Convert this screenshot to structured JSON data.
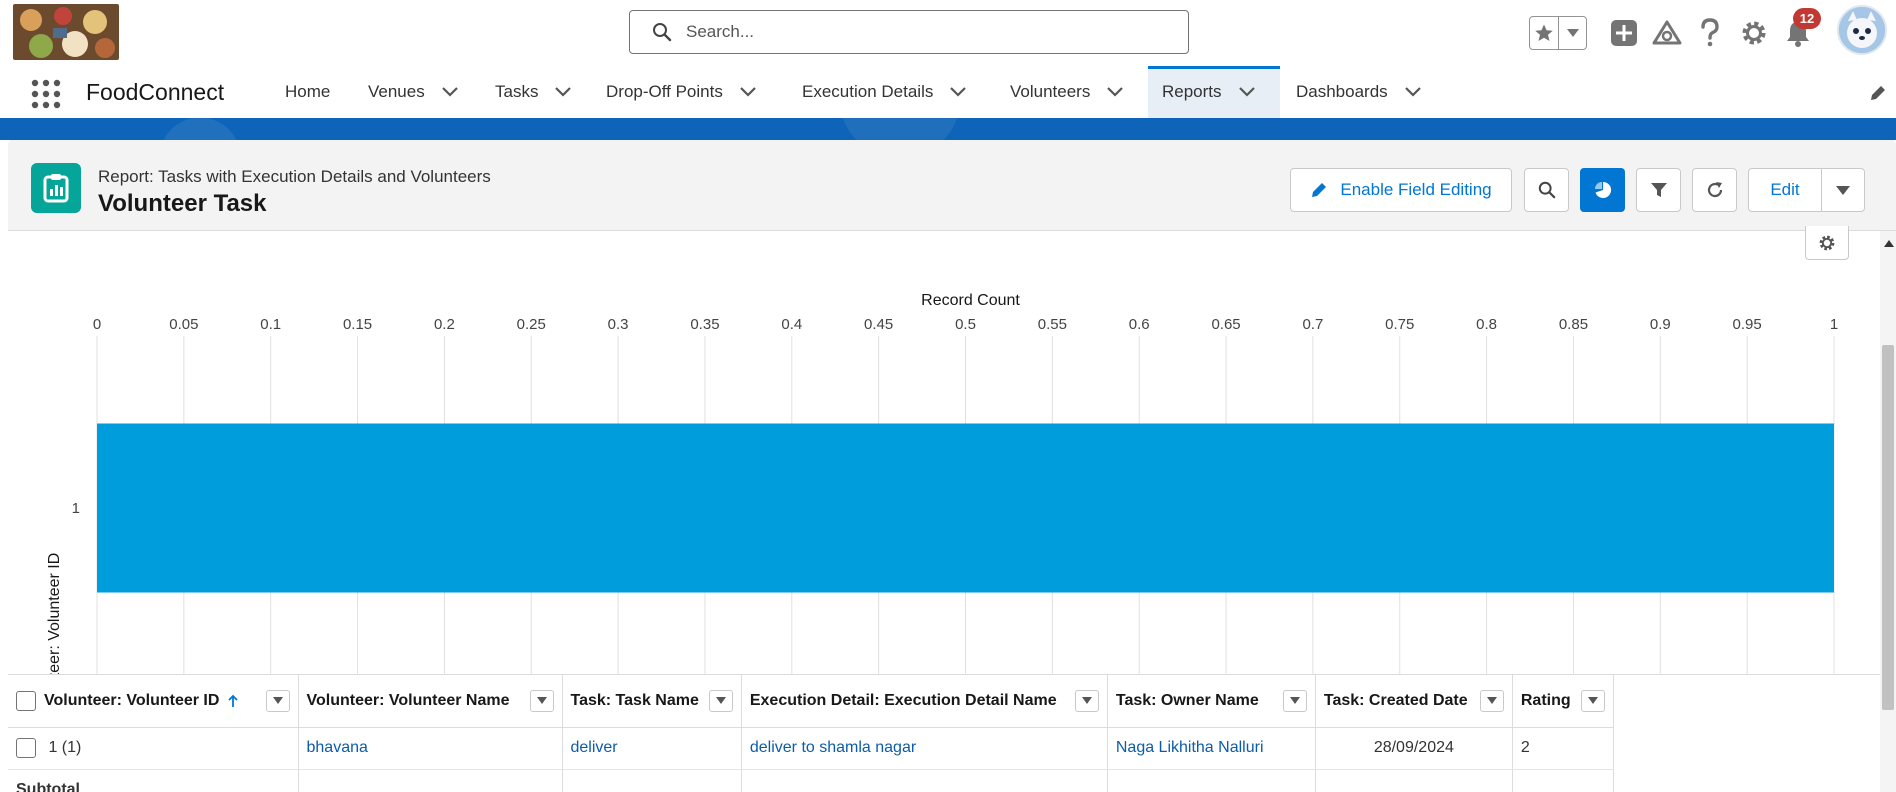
{
  "header": {
    "search_placeholder": "Search...",
    "notification_count": "12"
  },
  "nav": {
    "app_name": "FoodConnect",
    "items": [
      {
        "label": "Home"
      },
      {
        "label": "Venues"
      },
      {
        "label": "Tasks"
      },
      {
        "label": "Drop-Off Points"
      },
      {
        "label": "Execution Details"
      },
      {
        "label": "Volunteers"
      },
      {
        "label": "Reports"
      },
      {
        "label": "Dashboards"
      }
    ],
    "active": "Reports"
  },
  "report": {
    "type_label": "Report: Tasks with Execution Details and Volunteers",
    "title": "Volunteer Task",
    "enable_field_editing": "Enable Field Editing",
    "edit_label": "Edit"
  },
  "chart_data": {
    "type": "bar",
    "orientation": "horizontal",
    "title": "",
    "xlabel": "Record Count",
    "ylabel": "Volunteer: Volunteer ID",
    "categories": [
      "1"
    ],
    "values": [
      1
    ],
    "xlim": [
      0,
      1
    ],
    "xticks": [
      "0",
      "0.05",
      "0.1",
      "0.15",
      "0.2",
      "0.25",
      "0.3",
      "0.35",
      "0.4",
      "0.45",
      "0.5",
      "0.55",
      "0.6",
      "0.65",
      "0.7",
      "0.75",
      "0.8",
      "0.85",
      "0.9",
      "0.95",
      "1"
    ],
    "bar_color": "#009ddc",
    "grid": true,
    "x_axis_position": "top"
  },
  "table": {
    "headers": [
      "Volunteer: Volunteer ID",
      "Volunteer: Volunteer Name",
      "Task: Task Name",
      "Execution Detail: Execution Detail Name",
      "Task: Owner Name",
      "Task: Created Date",
      "Rating"
    ],
    "rows": [
      [
        "1 (1)",
        "bhavana",
        "deliver",
        "deliver to shamla nagar",
        "Naga Likhitha Nalluri",
        "28/09/2024",
        "2"
      ]
    ],
    "subtotal_label": "Subtotal"
  },
  "colors": {
    "brand": "#0176d3",
    "nav_band": "#0e64b8",
    "report_icon": "#06a59a",
    "badge": "#c23934"
  }
}
